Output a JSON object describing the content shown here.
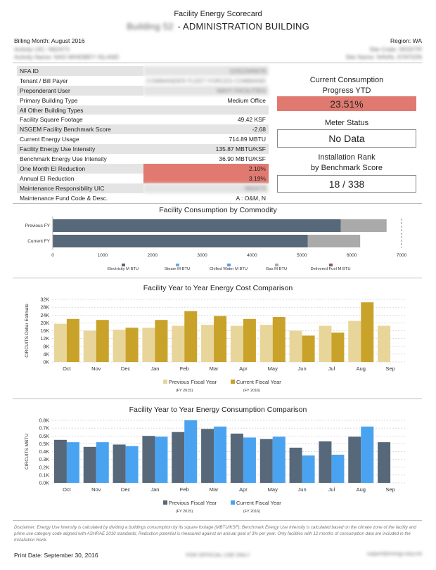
{
  "header": {
    "title": "Facility Energy Scorecard",
    "building_name": "ADMINISTRATION BUILDING",
    "building_prefix": "Building 52",
    "separator": "-",
    "billing_month": "Billing Month: August 2016",
    "region": "Region: WA",
    "activity_uic": "Activity UIC: N62473",
    "site_code": "Site Code: 5R3XTR",
    "activity_name": "Activity Name: NAS WHIDBEY ISLAND",
    "site_name": "Site Name: NAVAL STATION"
  },
  "info": [
    {
      "label": "NFA ID",
      "value": "12312345678",
      "blur": true,
      "hl": false
    },
    {
      "label": "Tenant / Bill Payer",
      "value": "COMMANDER FLEET FORCES COMMAND",
      "blur": true,
      "hl": false
    },
    {
      "label": "Preponderant User",
      "value": "NAVY FACILITIES",
      "blur": true,
      "hl": false
    },
    {
      "label": "Primary Building Type",
      "value": "Medium Office",
      "blur": false,
      "hl": false
    },
    {
      "label": "All Other Building Types",
      "value": "",
      "blur": false,
      "hl": false
    },
    {
      "label": "Facility Square Footage",
      "value": "49.42 KSF",
      "blur": false,
      "hl": false
    },
    {
      "label": "NSGEM Facility Benchmark Score",
      "value": "-2.68",
      "blur": false,
      "hl": false
    },
    {
      "label": "Current Energy Usage",
      "value": "714.89 MBTU",
      "blur": false,
      "hl": false
    },
    {
      "label": "Facility Energy Use Intensity",
      "value": "135.87 MBTU/KSF",
      "blur": false,
      "hl": false
    },
    {
      "label": "Benchmark Energy Use Intensity",
      "value": "36.90 MBTU/KSF",
      "blur": false,
      "hl": false
    },
    {
      "label": "One Month EI Reduction",
      "value": "2.10%",
      "blur": false,
      "hl": true
    },
    {
      "label": "Annual EI Reduction",
      "value": "3.19%",
      "blur": false,
      "hl": true
    },
    {
      "label": "Maintenance Responsibility UIC",
      "value": "N62473",
      "blur": true,
      "hl": false
    },
    {
      "label": "Maintenance Fund Code & Desc.",
      "value": "A : O&M, N",
      "blur": false,
      "hl": false
    }
  ],
  "kpi": {
    "progress_label_1": "Current Consumption",
    "progress_label_2": "Progress YTD",
    "progress_value": "23.51%",
    "meter_label": "Meter Status",
    "meter_value": "No Data",
    "rank_label_1": "Installation Rank",
    "rank_label_2": "by Benchmark Score",
    "rank_value": "18 / 338"
  },
  "footer": {
    "disclaimer": "Disclaimer: Energy Use Intensity is calculated by dividing a buildings consumption by its square footage (MBTU/KSF); Benchmark Energy Use Intensity is calculated based on the climate zone of the facility and prime use category code aligned with ASHRAE 2010 standards; Reduction potential is measured against an annual goal of 3% per year. Only facilities with 12 months of consumption data are included in the Installation Rank.",
    "print_date": "Print Date: September 30, 2016",
    "fouo": "FOR OFFICIAL USE ONLY",
    "email": "support@energy.navy.mil"
  },
  "colors": {
    "highlight": "#e07a70",
    "electricity": "#56687a",
    "other": "#aaaaaa",
    "prev_cost": "#e8d59a",
    "curr_cost": "#c9a22a",
    "prev_cons": "#56687a",
    "curr_cons": "#4aa3f0"
  },
  "chart_data": [
    {
      "type": "bar",
      "orientation": "horizontal",
      "stacked": true,
      "title": "Facility Consumption by Commodity",
      "categories": [
        "Previous FY",
        "Current FY"
      ],
      "series": [
        {
          "name": "Electricity M BTU",
          "values": [
            5780,
            5120
          ]
        },
        {
          "name": "Steam M BTU",
          "values": [
            0,
            0
          ]
        },
        {
          "name": "Chilled Water M BTU",
          "values": [
            0,
            0
          ]
        },
        {
          "name": "Gas M BTU",
          "values": [
            920,
            1050
          ]
        },
        {
          "name": "Delivered Fuel M BTU",
          "values": [
            0,
            0
          ]
        }
      ],
      "xlim": [
        0,
        7000
      ],
      "xticks": [
        0,
        1000,
        2000,
        3000,
        4000,
        5000,
        6000,
        7000
      ],
      "legend": "bottom"
    },
    {
      "type": "bar",
      "title": "Facility Year to Year Energy Cost Comparison",
      "ylabel": "CIRCUITS Dollar Estimate",
      "categories": [
        "Oct",
        "Nov",
        "Dec",
        "Jan",
        "Feb",
        "Mar",
        "Apr",
        "May",
        "Jun",
        "Jul",
        "Aug",
        "Sep"
      ],
      "series": [
        {
          "name": "Previous Fiscal Year",
          "sub": "(FY 2015)",
          "values": [
            19500,
            16000,
            16500,
            17500,
            18500,
            19000,
            18500,
            19000,
            16000,
            18500,
            21000,
            18500
          ]
        },
        {
          "name": "Current Fiscal Year",
          "sub": "(FY 2016)",
          "values": [
            22000,
            21500,
            17500,
            21500,
            26000,
            23500,
            22000,
            23000,
            13500,
            15000,
            30500,
            null
          ]
        }
      ],
      "ylim": [
        0,
        32000
      ],
      "yticks": [
        0,
        4000,
        8000,
        12000,
        16000,
        20000,
        24000,
        28000,
        32000
      ],
      "ytick_labels": [
        "0K",
        "4K",
        "8K",
        "12K",
        "16K",
        "20K",
        "24K",
        "28K",
        "32K"
      ],
      "grid": true,
      "legend": "bottom"
    },
    {
      "type": "bar",
      "title": "Facility Year to Year Energy Consumption Comparison",
      "ylabel": "CIRCUITS MBTU",
      "categories": [
        "Oct",
        "Nov",
        "Dec",
        "Jan",
        "Feb",
        "Mar",
        "Apr",
        "May",
        "Jun",
        "Jul",
        "Aug",
        "Sep"
      ],
      "series": [
        {
          "name": "Previous Fiscal Year",
          "sub": "(FY 2015)",
          "values": [
            0.55,
            0.46,
            0.49,
            0.6,
            0.65,
            0.69,
            0.63,
            0.56,
            0.45,
            0.53,
            0.59,
            0.52
          ]
        },
        {
          "name": "Current Fiscal Year",
          "sub": "(FY 2016)",
          "values": [
            0.52,
            0.52,
            0.47,
            0.59,
            0.8,
            0.72,
            0.58,
            0.59,
            0.35,
            0.36,
            0.72,
            null
          ]
        }
      ],
      "ylim": [
        0,
        0.8
      ],
      "yticks": [
        0,
        0.1,
        0.2,
        0.3,
        0.4,
        0.5,
        0.6,
        0.7,
        0.8
      ],
      "ytick_labels": [
        "0.0K",
        "0.1K",
        "0.2K",
        "0.3K",
        "0.4K",
        "0.5K",
        "0.6K",
        "0.7K",
        "0.8K"
      ],
      "grid": true,
      "legend": "bottom"
    }
  ]
}
